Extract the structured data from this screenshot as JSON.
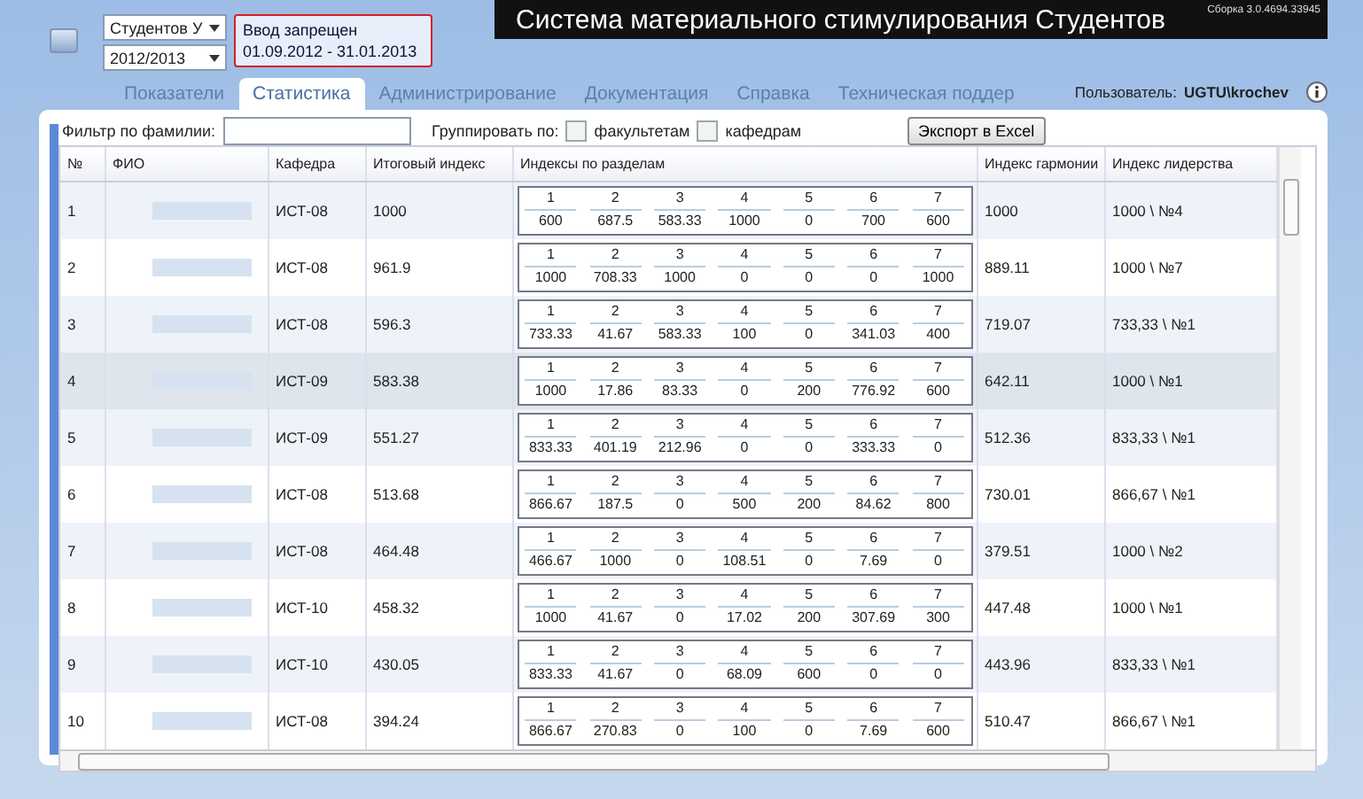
{
  "selectors": [
    {
      "value": "Студентов У"
    },
    {
      "value": "2012/2013"
    }
  ],
  "notice": {
    "title": "Ввод запрещен",
    "dates": "01.09.2012 - 31.01.2013"
  },
  "header": {
    "title": "Система материального стимулирования Студентов",
    "build": "Сборка 3.0.4694.33945"
  },
  "tabs": [
    {
      "label": "Показатели",
      "selected": false
    },
    {
      "label": "Статистика",
      "selected": true
    },
    {
      "label": "Администрирование",
      "selected": false
    },
    {
      "label": "Документация",
      "selected": false
    },
    {
      "label": "Справка",
      "selected": false
    },
    {
      "label": "Техническая поддер",
      "selected": false
    }
  ],
  "user": {
    "label": "Пользователь:",
    "name": "UGTU\\krochev"
  },
  "filter": {
    "label": "Фильтр по фамилии:"
  },
  "grouping": {
    "label": "Группировать по:",
    "options": [
      {
        "label": "факультетам",
        "checked": false
      },
      {
        "label": "кафедрам",
        "checked": false
      }
    ]
  },
  "export_button": "Экспорт в Excel",
  "table": {
    "columns": [
      "№",
      "ФИО",
      "Кафедра",
      "Итоговый индекс",
      "Индексы по разделам",
      "Индекс гармонии",
      "Индекс лидерства"
    ],
    "rows": [
      {
        "num": "1",
        "kafedra": "ИСТ-08",
        "total": "1000",
        "sections": [
          {
            "label": "1",
            "value": "600"
          },
          {
            "label": "2",
            "value": "687.5"
          },
          {
            "label": "3",
            "value": "583.33"
          },
          {
            "label": "4",
            "value": "1000"
          },
          {
            "label": "5",
            "value": "0"
          },
          {
            "label": "6",
            "value": "700"
          },
          {
            "label": "7",
            "value": "600"
          }
        ],
        "harmony": "1000",
        "leadership": "1000 \\ №4",
        "selected": false
      },
      {
        "num": "2",
        "kafedra": "ИСТ-08",
        "total": "961.9",
        "sections": [
          {
            "label": "1",
            "value": "1000"
          },
          {
            "label": "2",
            "value": "708.33"
          },
          {
            "label": "3",
            "value": "1000"
          },
          {
            "label": "4",
            "value": "0"
          },
          {
            "label": "5",
            "value": "0"
          },
          {
            "label": "6",
            "value": "0"
          },
          {
            "label": "7",
            "value": "1000"
          }
        ],
        "harmony": "889.11",
        "leadership": "1000 \\ №7",
        "selected": false
      },
      {
        "num": "3",
        "kafedra": "ИСТ-08",
        "total": "596.3",
        "sections": [
          {
            "label": "1",
            "value": "733.33"
          },
          {
            "label": "2",
            "value": "41.67"
          },
          {
            "label": "3",
            "value": "583.33"
          },
          {
            "label": "4",
            "value": "100"
          },
          {
            "label": "5",
            "value": "0"
          },
          {
            "label": "6",
            "value": "341.03"
          },
          {
            "label": "7",
            "value": "400"
          }
        ],
        "harmony": "719.07",
        "leadership": "733,33 \\ №1",
        "selected": false
      },
      {
        "num": "4",
        "kafedra": "ИСТ-09",
        "total": "583.38",
        "sections": [
          {
            "label": "1",
            "value": "1000"
          },
          {
            "label": "2",
            "value": "17.86"
          },
          {
            "label": "3",
            "value": "83.33"
          },
          {
            "label": "4",
            "value": "0"
          },
          {
            "label": "5",
            "value": "200"
          },
          {
            "label": "6",
            "value": "776.92"
          },
          {
            "label": "7",
            "value": "600"
          }
        ],
        "harmony": "642.11",
        "leadership": "1000 \\ №1",
        "selected": true
      },
      {
        "num": "5",
        "kafedra": "ИСТ-09",
        "total": "551.27",
        "sections": [
          {
            "label": "1",
            "value": "833.33"
          },
          {
            "label": "2",
            "value": "401.19"
          },
          {
            "label": "3",
            "value": "212.96"
          },
          {
            "label": "4",
            "value": "0"
          },
          {
            "label": "5",
            "value": "0"
          },
          {
            "label": "6",
            "value": "333.33"
          },
          {
            "label": "7",
            "value": "0"
          }
        ],
        "harmony": "512.36",
        "leadership": "833,33 \\ №1",
        "selected": false
      },
      {
        "num": "6",
        "kafedra": "ИСТ-08",
        "total": "513.68",
        "sections": [
          {
            "label": "1",
            "value": "866.67"
          },
          {
            "label": "2",
            "value": "187.5"
          },
          {
            "label": "3",
            "value": "0"
          },
          {
            "label": "4",
            "value": "500"
          },
          {
            "label": "5",
            "value": "200"
          },
          {
            "label": "6",
            "value": "84.62"
          },
          {
            "label": "7",
            "value": "800"
          }
        ],
        "harmony": "730.01",
        "leadership": "866,67 \\ №1",
        "selected": false
      },
      {
        "num": "7",
        "kafedra": "ИСТ-08",
        "total": "464.48",
        "sections": [
          {
            "label": "1",
            "value": "466.67"
          },
          {
            "label": "2",
            "value": "1000"
          },
          {
            "label": "3",
            "value": "0"
          },
          {
            "label": "4",
            "value": "108.51"
          },
          {
            "label": "5",
            "value": "0"
          },
          {
            "label": "6",
            "value": "7.69"
          },
          {
            "label": "7",
            "value": "0"
          }
        ],
        "harmony": "379.51",
        "leadership": "1000 \\ №2",
        "selected": false
      },
      {
        "num": "8",
        "kafedra": "ИСТ-10",
        "total": "458.32",
        "sections": [
          {
            "label": "1",
            "value": "1000"
          },
          {
            "label": "2",
            "value": "41.67"
          },
          {
            "label": "3",
            "value": "0"
          },
          {
            "label": "4",
            "value": "17.02"
          },
          {
            "label": "5",
            "value": "200"
          },
          {
            "label": "6",
            "value": "307.69"
          },
          {
            "label": "7",
            "value": "300"
          }
        ],
        "harmony": "447.48",
        "leadership": "1000 \\ №1",
        "selected": false
      },
      {
        "num": "9",
        "kafedra": "ИСТ-10",
        "total": "430.05",
        "sections": [
          {
            "label": "1",
            "value": "833.33"
          },
          {
            "label": "2",
            "value": "41.67"
          },
          {
            "label": "3",
            "value": "0"
          },
          {
            "label": "4",
            "value": "68.09"
          },
          {
            "label": "5",
            "value": "600"
          },
          {
            "label": "6",
            "value": "0"
          },
          {
            "label": "7",
            "value": "0"
          }
        ],
        "harmony": "443.96",
        "leadership": "833,33 \\ №1",
        "selected": false
      },
      {
        "num": "10",
        "kafedra": "ИСТ-08",
        "total": "394.24",
        "sections": [
          {
            "label": "1",
            "value": "866.67"
          },
          {
            "label": "2",
            "value": "270.83"
          },
          {
            "label": "3",
            "value": "0"
          },
          {
            "label": "4",
            "value": "100"
          },
          {
            "label": "5",
            "value": "0"
          },
          {
            "label": "6",
            "value": "7.69"
          },
          {
            "label": "7",
            "value": "600"
          }
        ],
        "harmony": "510.47",
        "leadership": "866,67 \\ №1",
        "selected": false
      }
    ]
  }
}
